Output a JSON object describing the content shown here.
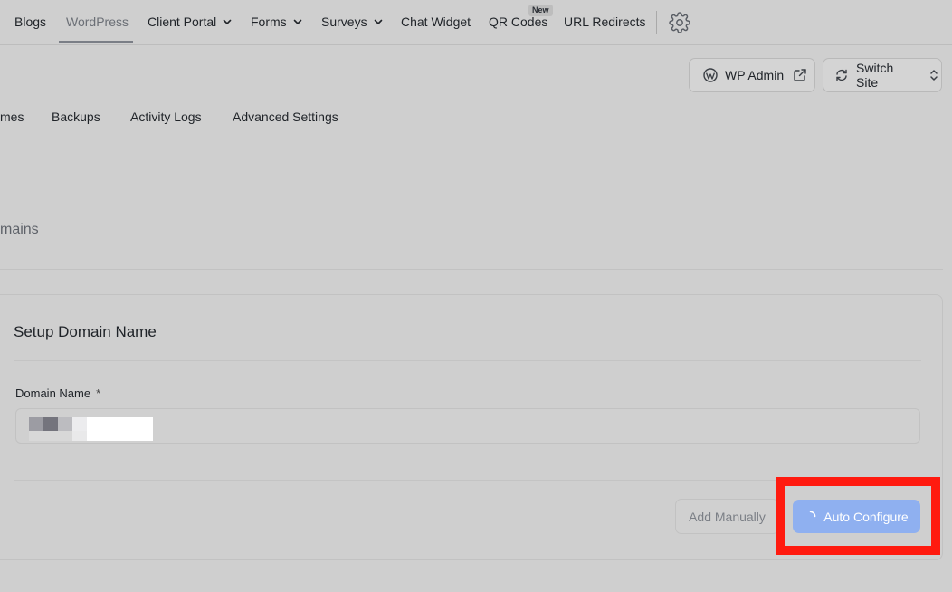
{
  "nav": {
    "items": [
      {
        "label": "Blogs"
      },
      {
        "label": "WordPress",
        "active": true
      },
      {
        "label": "Client Portal",
        "has_dropdown": true
      },
      {
        "label": "Forms",
        "has_dropdown": true
      },
      {
        "label": "Surveys",
        "has_dropdown": true
      },
      {
        "label": "Chat Widget"
      },
      {
        "label": "QR Codes",
        "badge": "New"
      },
      {
        "label": "URL Redirects"
      }
    ],
    "settings_icon": "gear-icon"
  },
  "actions": {
    "wp_admin_label": "WP Admin",
    "wp_admin_icon": "wordpress-icon",
    "wp_admin_trailing_icon": "external-link-icon",
    "switch_site_label": "Switch Site",
    "switch_site_icon": "switch-arrows-icon",
    "switch_site_trailing_icon": "chevron-up-down-icon"
  },
  "subtabs": [
    "mes",
    "Backups",
    "Activity Logs",
    "Advanced Settings"
  ],
  "section": {
    "label": "mains"
  },
  "card": {
    "title": "Setup Domain Name",
    "field_label": "Domain Name",
    "required_mark": "*",
    "domain_value": "",
    "add_manually_label": "Add Manually",
    "auto_configure_label": "Auto Configure",
    "auto_configure_loading": true
  },
  "colors": {
    "primary_button": "#8fb0f0",
    "highlight": "#ff1a0f",
    "background": "#cfcfcf"
  }
}
